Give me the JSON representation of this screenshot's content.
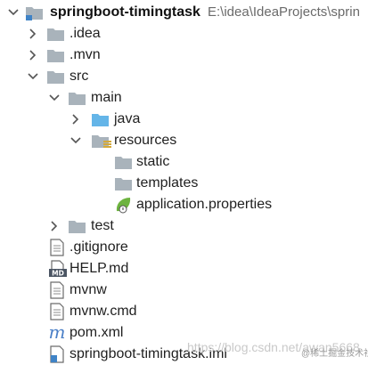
{
  "root": {
    "name": "springboot-timingtask",
    "path": "E:\\idea\\IdeaProjects\\sprin"
  },
  "items": {
    "idea": ".idea",
    "mvn": ".mvn",
    "src": "src",
    "main": "main",
    "java": "java",
    "resources": "resources",
    "static": "static",
    "templates": "templates",
    "application": "application.properties",
    "test": "test",
    "gitignore": ".gitignore",
    "help": "HELP.md",
    "mvnw": "mvnw",
    "mvnwcmd": "mvnw.cmd",
    "pom": "pom.xml",
    "iml": "springboot-timingtask.iml"
  },
  "icons": {
    "md_text": "MD",
    "maven_text": "m"
  },
  "watermark": "https://blog.csdn.net/awan5668",
  "badge": "@稀土掘金技术社区",
  "colors": {
    "folder": "#a9b3bb",
    "source_folder": "#64b5e8",
    "spring_green": "#6db33f",
    "maven_blue": "#4a7fc7"
  }
}
